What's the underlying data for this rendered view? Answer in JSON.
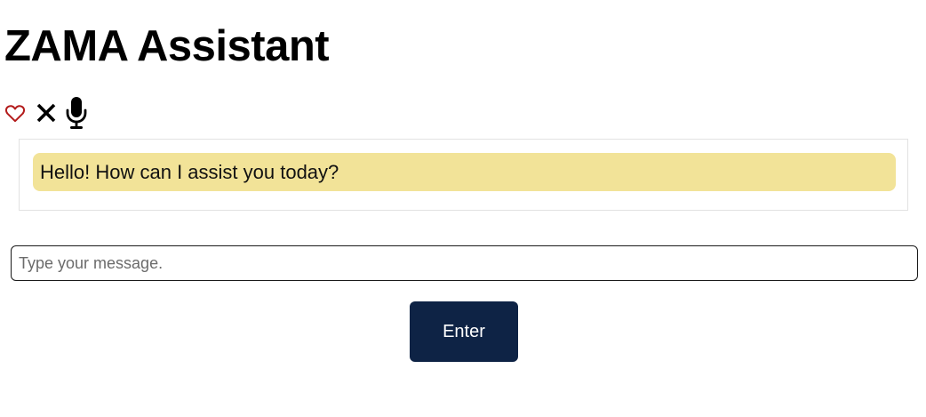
{
  "header": {
    "title": "ZAMA Assistant"
  },
  "toolbar": {
    "icons": [
      {
        "name": "heart-outline",
        "color": "#b31b1b"
      },
      {
        "name": "close",
        "color": "#000000"
      },
      {
        "name": "microphone",
        "color": "#000000"
      }
    ]
  },
  "chat": {
    "messages": [
      {
        "sender": "assistant",
        "text": "Hello! How can I assist you today?"
      }
    ],
    "bubble_color": "#f2e398"
  },
  "composer": {
    "input_value": "",
    "placeholder": "Type your message.",
    "submit_label": "Enter",
    "submit_color": "#0e2345"
  }
}
